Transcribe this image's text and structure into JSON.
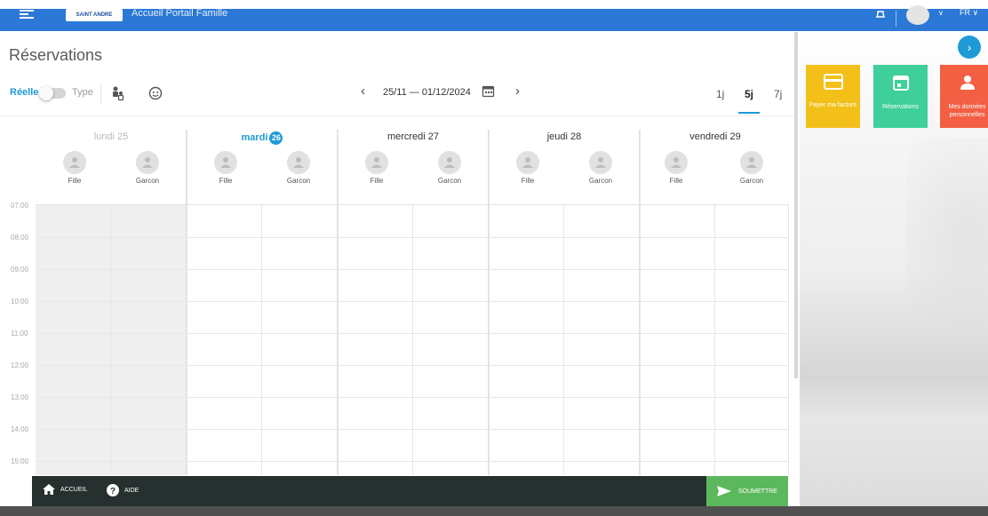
{
  "topbar": {
    "logo_text": "SAINT ANDRE",
    "app_title": "Accueil Portail Famille",
    "language": "FR",
    "colors": {
      "brand": "#2b78d6"
    }
  },
  "page": {
    "title": "Réservations"
  },
  "toolbar": {
    "mode_real_label": "Réelle",
    "mode_type_label": "Type",
    "date_range": "25/11 — 01/12/2024",
    "views": [
      "1j",
      "5j",
      "7j"
    ],
    "active_view": "5j",
    "icons": [
      "family-icon",
      "face-icon",
      "calendar-icon",
      "chevron-left-icon",
      "chevron-right-icon"
    ]
  },
  "calendar": {
    "days": [
      {
        "label": "lundi 25",
        "state": "past"
      },
      {
        "label": "mardi",
        "badge": "26",
        "state": "today"
      },
      {
        "label": "mercredi 27",
        "state": "normal"
      },
      {
        "label": "jeudi 28",
        "state": "normal"
      },
      {
        "label": "vendredi 29",
        "state": "normal"
      }
    ],
    "children": [
      "Fille",
      "Garcon"
    ],
    "hours": [
      "07:00",
      "08:00",
      "09:00",
      "10:00",
      "11:00",
      "12:00",
      "13:00",
      "14:00",
      "15:00"
    ],
    "colors": {
      "accent": "#1e9ad6",
      "past_column": "#efefef"
    }
  },
  "bottom_bar": {
    "home_label": "ACCUEIL",
    "help_label": "AIDE",
    "submit_label": "SOUMETTRE",
    "colors": {
      "bar": "#26302f",
      "submit": "#5cb85c"
    }
  },
  "right_panel": {
    "tiles": [
      {
        "label": "Payer ma facture",
        "color": "#f3c01a",
        "icon": "credit-card-icon"
      },
      {
        "label": "Réservations",
        "color": "#3fcf9a",
        "icon": "calendar-icon"
      },
      {
        "label": "Mes données personnelles",
        "color": "#f25f43",
        "icon": "person-icon"
      }
    ]
  }
}
